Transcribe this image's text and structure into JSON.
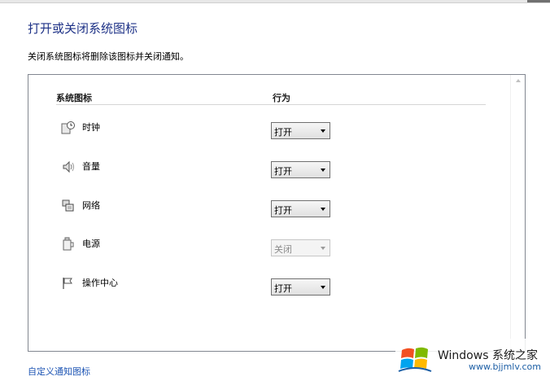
{
  "page": {
    "title": "打开或关闭系统图标",
    "description": "关闭系统图标将删除该图标并关闭通知。",
    "customize_link": "自定义通知图标"
  },
  "table": {
    "headers": {
      "icon": "系统图标",
      "behavior": "行为"
    },
    "rows": [
      {
        "icon": "clock-icon",
        "label": "时钟",
        "behavior": "打开",
        "enabled": true
      },
      {
        "icon": "speaker-icon",
        "label": "音量",
        "behavior": "打开",
        "enabled": true
      },
      {
        "icon": "network-icon",
        "label": "网络",
        "behavior": "打开",
        "enabled": true
      },
      {
        "icon": "power-icon",
        "label": "电源",
        "behavior": "关闭",
        "enabled": false
      },
      {
        "icon": "flag-icon",
        "label": "操作中心",
        "behavior": "打开",
        "enabled": true
      }
    ]
  },
  "watermark": {
    "brand": "Windows 系统之家",
    "url": "www.bjjmlv.com"
  }
}
